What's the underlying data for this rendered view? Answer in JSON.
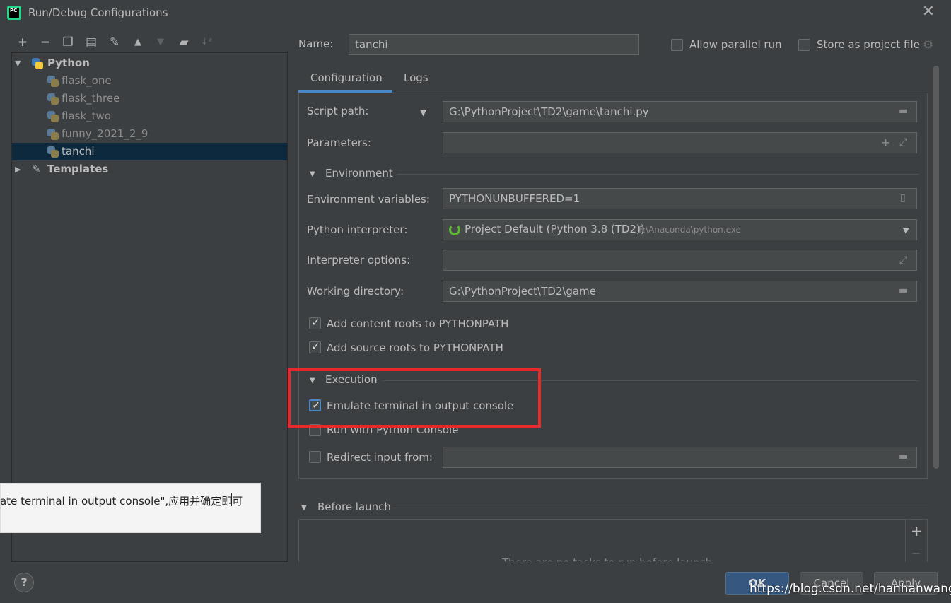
{
  "window": {
    "title": "Run/Debug Configurations",
    "app_icon_text": "PC",
    "close_symbol": "✕"
  },
  "toolbar": {
    "icons": [
      "add-icon",
      "remove-icon",
      "copy-icon",
      "save-icon",
      "wrench-icon",
      "arrow-up-icon",
      "arrow-down-icon",
      "folder-add-icon",
      "sort-icon"
    ]
  },
  "tree": {
    "python_group": "Python",
    "items": [
      "flask_one",
      "flask_three",
      "flask_two",
      "funny_2021_2_9",
      "tanchi"
    ],
    "selected": "tanchi",
    "templates": "Templates"
  },
  "header": {
    "name_label": "Name:",
    "name_value": "tanchi",
    "allow_parallel": "Allow parallel run",
    "store_as_project": "Store as project file"
  },
  "tabs": {
    "configuration": "Configuration",
    "logs": "Logs"
  },
  "form": {
    "script_path_label": "Script path:",
    "script_path_value": "G:\\PythonProject\\TD2\\game\\tanchi.py",
    "parameters_label": "Parameters:",
    "environment_section": "Environment",
    "env_vars_label": "Environment variables:",
    "env_vars_value": "PYTHONUNBUFFERED=1",
    "interpreter_label": "Python interpreter:",
    "interpreter_value": "Project Default (Python 3.8 (TD2))",
    "interpreter_path": "F:\\Anaconda\\python.exe",
    "interp_options_label": "Interpreter options:",
    "working_dir_label": "Working directory:",
    "working_dir_value": "G:\\PythonProject\\TD2\\game",
    "add_content_roots": "Add content roots to PYTHONPATH",
    "add_source_roots": "Add source roots to PYTHONPATH",
    "execution_section": "Execution",
    "emulate_terminal": "Emulate terminal in output console",
    "run_with_console": "Run with Python Console",
    "redirect_input": "Redirect input from:"
  },
  "before_launch": {
    "title": "Before launch",
    "empty_message": "There are no tasks to run before launch"
  },
  "buttons": {
    "ok": "OK",
    "cancel": "Cancel",
    "apply": "Apply",
    "help": "?"
  },
  "overlay_note": "ate terminal in output console\",应用并确定即可",
  "watermark": "https://blog.csdn.net/hanhanwanghaha",
  "colors": {
    "background": "#3c3f41",
    "selection": "#0d293e",
    "tab_underline": "#4a88c7",
    "highlight": "#e8282b",
    "ok_button": "#365880"
  }
}
